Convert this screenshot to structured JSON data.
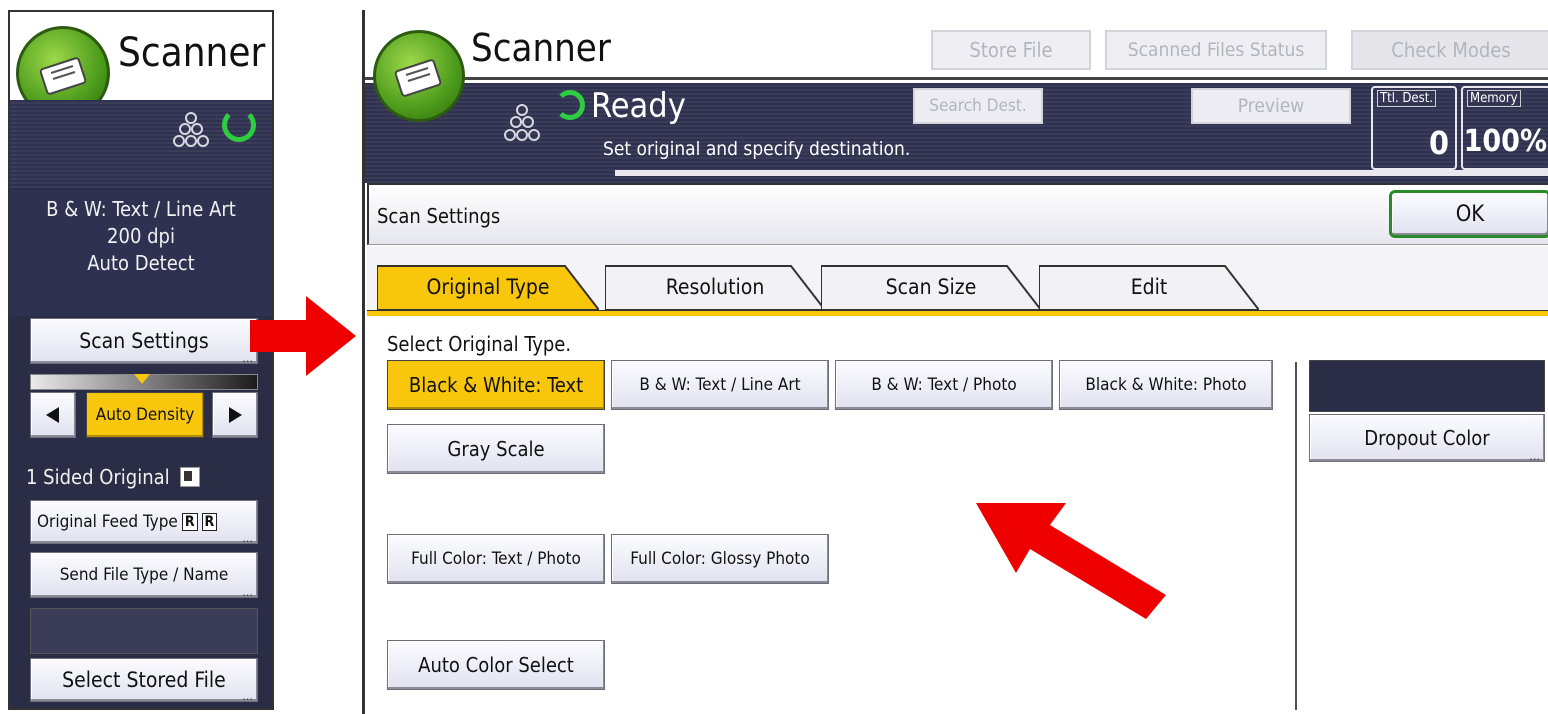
{
  "left_panel": {
    "title": "Scanner",
    "settings_line1": "B & W: Text / Line Art",
    "settings_line2": "200 dpi",
    "settings_line3": "Auto Detect",
    "scan_settings_label": "Scan Settings",
    "density_label": "Auto Density",
    "sided_label": "1 Sided Original",
    "feed_type_label": "Original Feed Type",
    "feed_badge_1": "R",
    "feed_badge_2": "R",
    "send_file_label": "Send File Type / Name",
    "stored_file_label": "Select Stored File"
  },
  "main": {
    "title": "Scanner",
    "store_file": "Store File",
    "scanned_files_status": "Scanned Files Status",
    "check_modes": "Check Modes",
    "status": "Ready",
    "status_message": "Set original and specify destination.",
    "search_dest": "Search Dest.",
    "preview": "Preview",
    "ttl_dest_label": "Ttl. Dest.",
    "ttl_dest_value": "0",
    "memory_label": "Memory",
    "memory_value": "100%",
    "dialog_title": "Scan Settings",
    "ok": "OK",
    "tabs": [
      "Original Type",
      "Resolution",
      "Scan Size",
      "Edit"
    ],
    "instruction": "Select Original Type.",
    "options": {
      "bw_text": "Black & White: Text",
      "bw_line_art": "B & W: Text / Line Art",
      "bw_photo_mix": "B & W: Text / Photo",
      "bw_photo": "Black & White: Photo",
      "gray": "Gray Scale",
      "fc_text_photo": "Full Color: Text / Photo",
      "fc_glossy": "Full Color: Glossy Photo",
      "auto_color": "Auto Color Select"
    },
    "dropout_color": "Dropout Color"
  },
  "colors": {
    "selected": "#f8c70c",
    "panel_dark": "#2b2d47",
    "arrow": "#ee0000",
    "ok_border": "#2a8a2a",
    "ready_ring": "#2ecc40"
  }
}
